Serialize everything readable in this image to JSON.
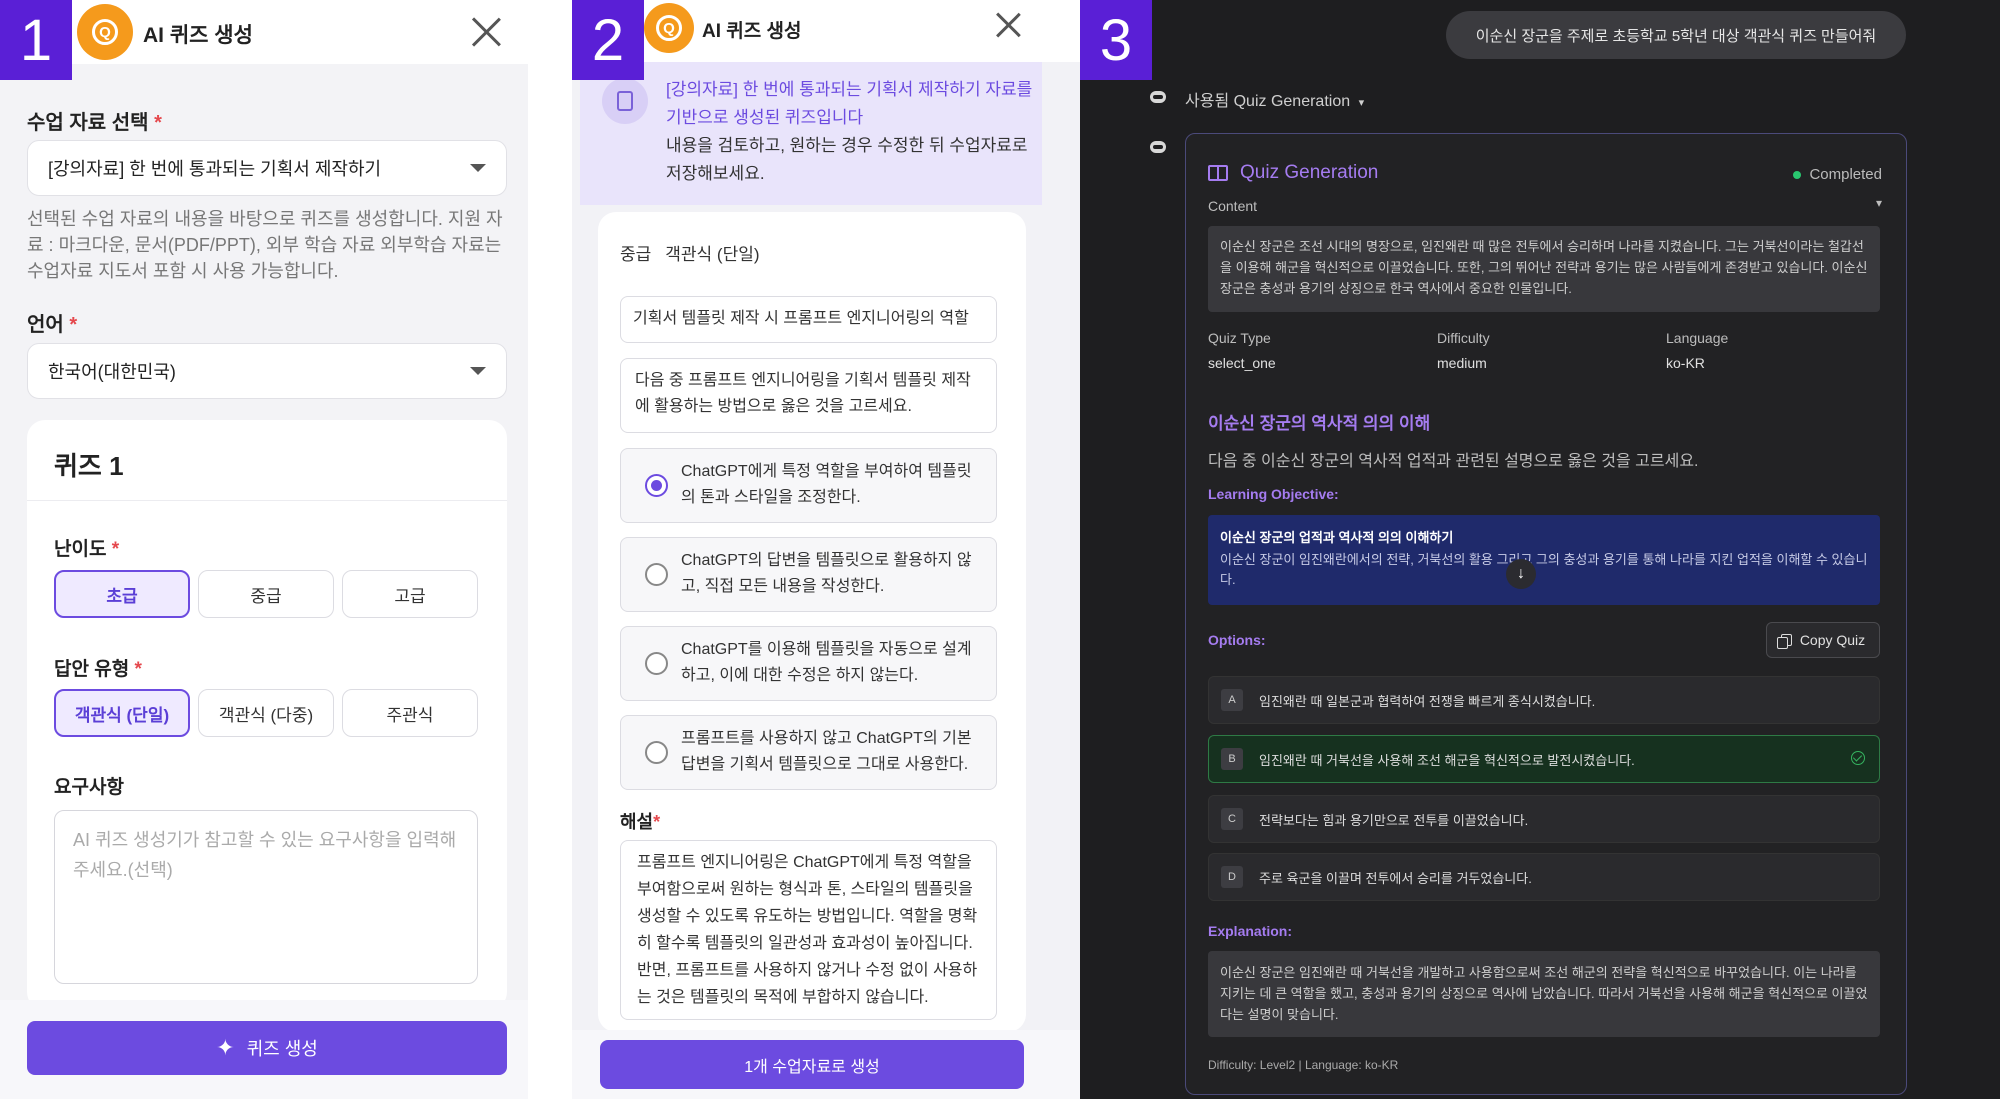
{
  "badges": [
    "1",
    "2",
    "3"
  ],
  "panel1": {
    "header": {
      "title": "AI 퀴즈 생성",
      "logo_letter": "Q"
    },
    "material": {
      "label": "수업 자료 선택",
      "required": "*",
      "value": "[강의자료] 한 번에 통과되는 기획서 제작하기",
      "help": "선택된 수업 자료의 내용을 바탕으로 퀴즈를 생성합니다. 지원 자료 : 마크다운, 문서(PDF/PPT), 외부 학습 자료 외부학습 자료는 수업자료 지도서 포함 시 사용 가능합니다."
    },
    "language": {
      "label": "언어",
      "required": "*",
      "value": "한국어(대한민국)"
    },
    "quiz": {
      "title": "퀴즈 1",
      "difficulty": {
        "label": "난이도",
        "required": "*",
        "options": [
          "초급",
          "중급",
          "고급"
        ],
        "selected": 0
      },
      "answer_type": {
        "label": "답안 유형",
        "required": "*",
        "options": [
          "객관식 (단일)",
          "객관식 (다중)",
          "주관식"
        ],
        "selected": 0
      },
      "requirements": {
        "label": "요구사항",
        "placeholder": "AI 퀴즈 생성기가 참고할 수 있는 요구사항을 입력해 주세요.(선택)"
      }
    },
    "generate_button": "퀴즈 생성",
    "accent": "#6c4be0"
  },
  "panel2": {
    "header": {
      "title": "AI 퀴즈 생성",
      "logo_letter": "Q"
    },
    "notice": {
      "highlight": "[강의자료] 한 번에 통과되는 기획서 제작하기",
      "highlight_rest": " 자료를 기반으로 생성된 퀴즈입니다",
      "body": "내용을 검토하고, 원하는 경우 수정한 뒤 수업자료로 저장해보세요."
    },
    "meta": {
      "difficulty": "중급",
      "type": "객관식 (단일)"
    },
    "title_value": "기획서 템플릿 제작 시 프롬프트 엔지니어링의 역할",
    "question": "다음 중 프롬프트 엔지니어링을 기획서 템플릿 제작에 활용하는 방법으로 옳은 것을 고르세요.",
    "options": [
      "ChatGPT에게 특정 역할을 부여하여 템플릿의 톤과 스타일을 조정한다.",
      "ChatGPT의 답변을 템플릿으로 활용하지 않고, 직접 모든 내용을 작성한다.",
      "ChatGPT를 이용해 템플릿을 자동으로 설계하고, 이에 대한 수정은 하지 않는다.",
      "프롬프트를 사용하지 않고 ChatGPT의 기본 답변을 기획서 템플릿으로 그대로 사용한다."
    ],
    "selected_option": 0,
    "explanation_label": "해설",
    "explanation_required": "*",
    "explanation": "프롬프트 엔지니어링은 ChatGPT에게 특정 역할을 부여함으로써 원하는 형식과 톤, 스타일의 템플릿을 생성할 수 있도록 유도하는 방법입니다. 역할을 명확히 할수록 템플릿의 일관성과 효과성이 높아집니다. 반면, 프롬프트를 사용하지 않거나 수정 없이 사용하는 것은 템플릿의 목적에 부합하지 않습니다.",
    "save_button": "1개 수업자료로 생성"
  },
  "panel3": {
    "user_message": "이순신 장군을 주제로 초등학교 5학년 대상 객관식 퀴즈 만들어줘",
    "used_tool": "사용됨 Quiz Generation",
    "card": {
      "title": "Quiz Generation",
      "status": "Completed",
      "content_label": "Content",
      "content": "이순신 장군은 조선 시대의 명장으로, 임진왜란 때 많은 전투에서 승리하며 나라를 지켰습니다. 그는 거북선이라는 철갑선을 이용해 해군을 혁신적으로 이끌었습니다. 또한, 그의 뛰어난 전략과 용기는 많은 사람들에게 존경받고 있습니다. 이순신 장군은 충성과 용기의 상징으로 한국 역사에서 중요한 인물입니다.",
      "quiz_type_label": "Quiz Type",
      "quiz_type": "select_one",
      "difficulty_label": "Difficulty",
      "difficulty": "medium",
      "language_label": "Language",
      "language": "ko-KR",
      "question_title": "이순신 장군의 역사적 의의 이해",
      "question": "다음 중 이순신 장군의 역사적 업적과 관련된 설명으로 옳은 것을 고르세요.",
      "objective_label": "Learning Objective:",
      "objective_title": "이순신 장군의 업적과 역사적 의의 이해하기",
      "objective_desc": "이순신 장군이 임진왜란에서의 전략, 거북선의 활용 그리고 그의 충성과 용기를 통해 나라를 지킨 업적을 이해할 수 있습니다.",
      "options_label": "Options:",
      "copy_button": "Copy Quiz",
      "options": [
        {
          "letter": "A",
          "text": "임진왜란 때 일본군과 협력하여 전쟁을 빠르게 종식시켰습니다."
        },
        {
          "letter": "B",
          "text": "임진왜란 때 거북선을 사용해 조선 해군을 혁신적으로 발전시켰습니다."
        },
        {
          "letter": "C",
          "text": "전략보다는 힘과 용기만으로 전투를 이끌었습니다."
        },
        {
          "letter": "D",
          "text": "주로 육군을 이끌며 전투에서 승리를 거두었습니다."
        }
      ],
      "correct_index": 1,
      "explanation_label": "Explanation:",
      "explanation": "이순신 장군은 임진왜란 때 거북선을 개발하고 사용함으로써 조선 해군의 전략을 혁신적으로 바꾸었습니다. 이는 나라를 지키는 데 큰 역할을 했고, 충성과 용기의 상징으로 역사에 남았습니다. 따라서 거북선을 사용해 해군을 혁신적으로 이끌었다는 설명이 맞습니다.",
      "footer": "Difficulty: Level2 | Language: ko-KR"
    }
  }
}
